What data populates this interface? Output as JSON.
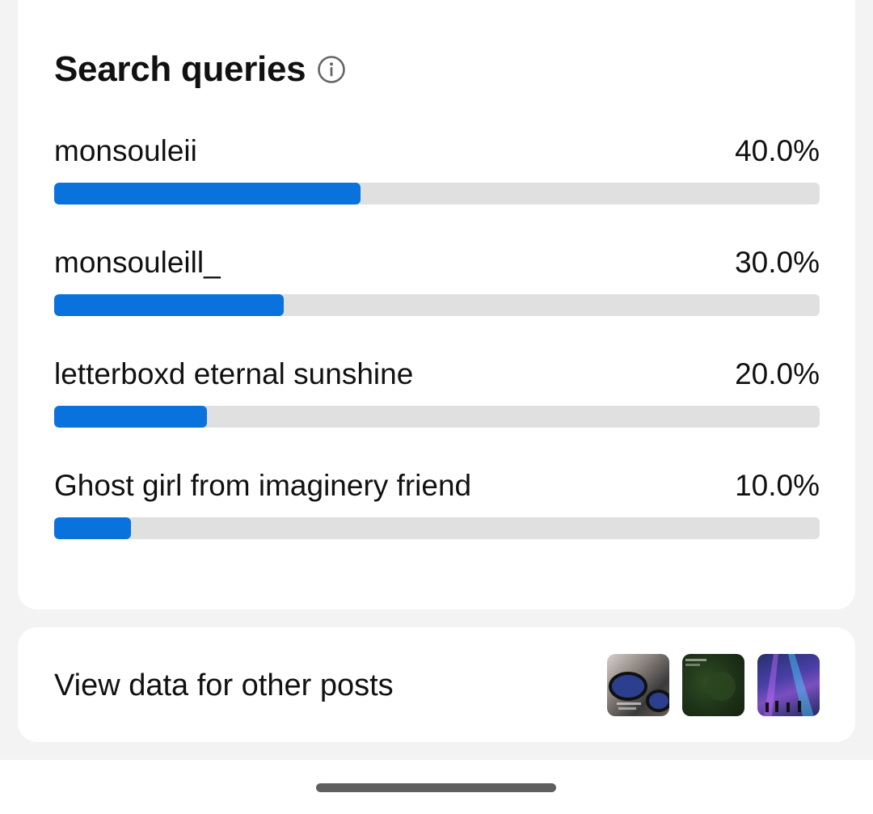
{
  "search_queries": {
    "title": "Search queries",
    "info_icon": "info-circle-icon",
    "items": [
      {
        "label": "monsouleii",
        "value": "40.0%",
        "fraction": 0.4
      },
      {
        "label": "monsouleill_",
        "value": "30.0%",
        "fraction": 0.3
      },
      {
        "label": "letterboxd eternal sunshine",
        "value": "20.0%",
        "fraction": 0.2
      },
      {
        "label": "Ghost girl from imaginery friend",
        "value": "10.0%",
        "fraction": 0.1
      }
    ]
  },
  "other_posts": {
    "label": "View data for other posts",
    "thumbnails": [
      "post-thumbnail-1",
      "post-thumbnail-2",
      "post-thumbnail-3"
    ]
  },
  "colors": {
    "bar_fill": "#0a72dc",
    "bar_track": "#e0e0e0",
    "page_background": "#f3f3f3",
    "card_background": "#ffffff"
  }
}
